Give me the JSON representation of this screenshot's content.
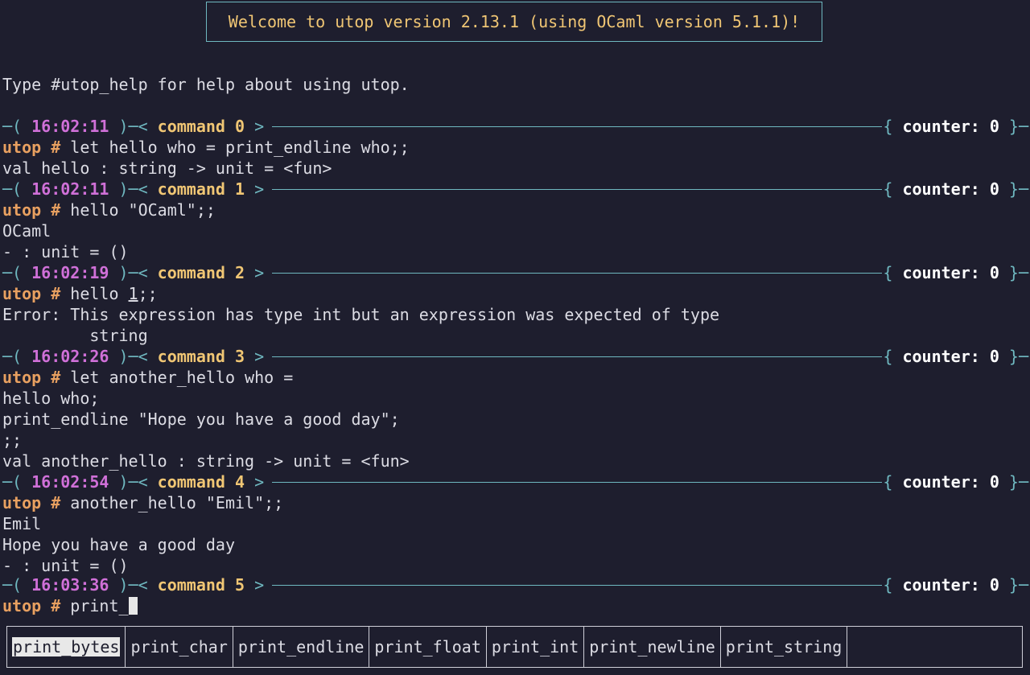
{
  "welcome": "Welcome to utop version 2.13.1 (using OCaml version 5.1.1)!",
  "help_line": "Type #utop_help for help about using utop.",
  "prompt_label": "utop #",
  "separator": {
    "counter_label": "counter:",
    "counter_value": "0"
  },
  "commands": [
    {
      "time": "16:02:11",
      "label": "command",
      "num": "0"
    },
    {
      "time": "16:02:11",
      "label": "command",
      "num": "1"
    },
    {
      "time": "16:02:19",
      "label": "command",
      "num": "2"
    },
    {
      "time": "16:02:26",
      "label": "command",
      "num": "3"
    },
    {
      "time": "16:02:54",
      "label": "command",
      "num": "4"
    },
    {
      "time": "16:03:36",
      "label": "command",
      "num": "5"
    }
  ],
  "c0": {
    "input": " let hello who = print_endline who;;",
    "out1": "val hello : string -> unit = <fun>"
  },
  "c1": {
    "input": " hello \"OCaml\";;",
    "out1": "OCaml",
    "out2": "- : unit = ()"
  },
  "c2": {
    "input_pre": " hello ",
    "input_ul": "1",
    "input_post": ";;",
    "out1": "Error: This expression has type int but an expression was expected of type",
    "out2": "         string"
  },
  "c3": {
    "input": " let another_hello who =",
    "l2": "hello who;",
    "l3": "print_endline \"Hope you have a good day\";",
    "l4": ";;",
    "out1": "val another_hello : string -> unit = <fun>"
  },
  "c4": {
    "input": " another_hello \"Emil\";;",
    "out1": "Emil",
    "out2": "Hope you have a good day",
    "out3": "- : unit = ()"
  },
  "c5": {
    "input": " print_"
  },
  "completions": [
    "print_bytes",
    "print_char",
    "print_endline",
    "print_float",
    "print_int",
    "print_newline",
    "print_string"
  ]
}
